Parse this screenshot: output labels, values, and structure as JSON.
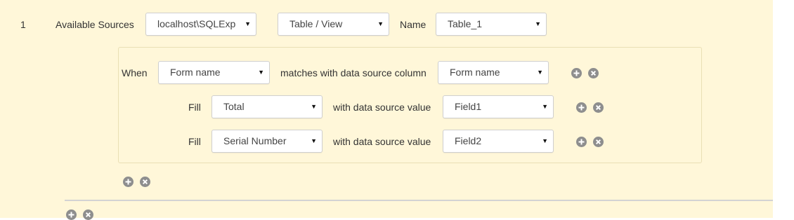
{
  "row": {
    "index": "1",
    "available_sources_label": "Available Sources",
    "source_select": "localhost\\SQLExp",
    "type_select": "Table / View",
    "name_label": "Name",
    "name_select": "Table_1"
  },
  "condition": {
    "when_label": "When",
    "when_select": "Form name",
    "matches_label": "matches with data source column",
    "column_select": "Form name"
  },
  "fills": [
    {
      "fill_label": "Fill",
      "field_select": "Total",
      "with_label": "with data source value",
      "value_select": "Field1"
    },
    {
      "fill_label": "Fill",
      "field_select": "Serial Number",
      "with_label": "with data source value",
      "value_select": "Field2"
    }
  ],
  "icons": {
    "add": "plus-circle-icon",
    "remove": "x-circle-icon"
  },
  "colors": {
    "panel_background": "#fff7d9",
    "icon_gray": "#8e8e8e"
  }
}
